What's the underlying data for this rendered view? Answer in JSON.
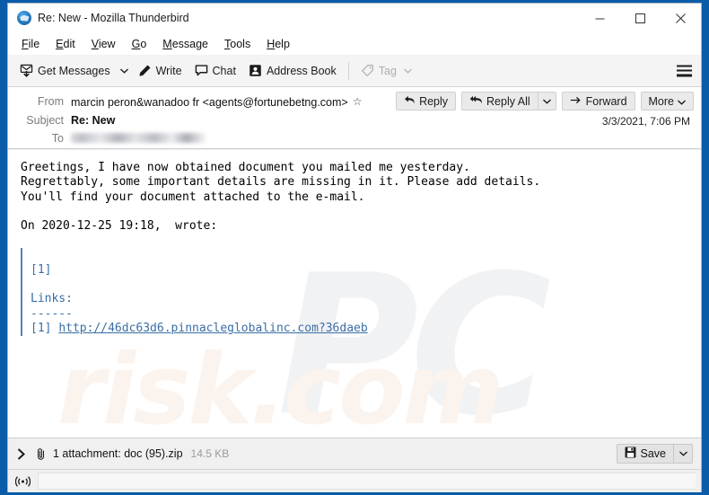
{
  "window": {
    "title": "Re: New - Mozilla Thunderbird",
    "logo_icon": "thunderbird-logo-icon",
    "controls": {
      "minimize": "minimize-icon",
      "maximize": "maximize-icon",
      "close": "close-icon"
    }
  },
  "menubar": {
    "items": [
      {
        "label": "File",
        "accel": "F"
      },
      {
        "label": "Edit",
        "accel": "E"
      },
      {
        "label": "View",
        "accel": "V"
      },
      {
        "label": "Go",
        "accel": "G"
      },
      {
        "label": "Message",
        "accel": "M"
      },
      {
        "label": "Tools",
        "accel": "T"
      },
      {
        "label": "Help",
        "accel": "H"
      }
    ]
  },
  "toolbar": {
    "get_messages": "Get Messages",
    "write": "Write",
    "chat": "Chat",
    "address_book": "Address Book",
    "tag": "Tag",
    "menu_icon": "hamburger-menu-icon"
  },
  "message_header": {
    "from_label": "From",
    "from_value": "marcin peron&wanadoo fr <agents@fortunebetng.com>",
    "subject_label": "Subject",
    "subject_value": "Re: New",
    "to_label": "To",
    "to_value": "",
    "date": "3/3/2021, 7:06 PM",
    "star_icon": "star-icon",
    "actions": {
      "reply": "Reply",
      "reply_all": "Reply All",
      "forward": "Forward",
      "more": "More"
    }
  },
  "body": {
    "paragraph": "Greetings, I have now obtained document you mailed me yesterday.\nRegrettably, some important details are missing in it. Please add details.\nYou'll find your document attached to the e-mail.\n\nOn 2020-12-25 19:18,  wrote:",
    "quote_ref": "[1]",
    "quote_links_heading": "Links:",
    "quote_rule": "------",
    "quote_link_index": "[1] ",
    "quote_link_text": "http://46dc63d6.pinnacleglobalinc.com?36daeb",
    "watermark_primary": "PC",
    "watermark_secondary": "risk.com"
  },
  "attachment": {
    "expander_icon": "chevron-right-icon",
    "clip_icon": "paperclip-icon",
    "label": "1 attachment: doc (95).zip",
    "size": "14.5 KB",
    "save_label": "Save",
    "save_icon": "floppy-disk-icon",
    "save_caret_icon": "chevron-down-icon"
  },
  "statusbar": {
    "icon": "broadcast-icon",
    "text": ""
  },
  "colors": {
    "desktop": "#0b5ca8",
    "toolbar_bg": "#f4f4f4",
    "quote_blue": "#3a6ea5",
    "quote_bar": "#5b7fbf",
    "disabled_text": "#aeaeae"
  }
}
